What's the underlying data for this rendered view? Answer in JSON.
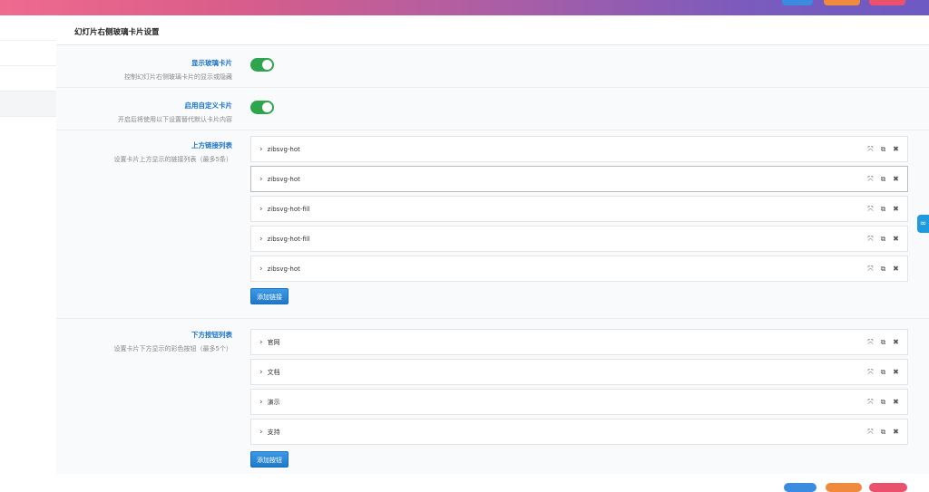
{
  "colors": {
    "accent": "#1a73c8",
    "toggle_on": "#2ea44f",
    "button": "#2587d6"
  },
  "section": {
    "title": "幻灯片右侧玻璃卡片设置"
  },
  "fields": {
    "show_card": {
      "title": "显示玻璃卡片",
      "desc": "控制幻灯片右侧玻璃卡片的显示或隐藏",
      "enabled": true
    },
    "custom_card": {
      "title": "启用自定义卡片",
      "desc": "开启后将使用以下设置替代默认卡片内容",
      "enabled": true
    },
    "link_list": {
      "title": "上方链接列表",
      "desc": "设置卡片上方显示的链接列表（最多5条）",
      "items": [
        {
          "label": "zibsvg-hot"
        },
        {
          "label": "zibsvg-hot"
        },
        {
          "label": "zibsvg-hot-fill"
        },
        {
          "label": "zibsvg-hot-fill"
        },
        {
          "label": "zibsvg-hot"
        }
      ],
      "add_label": "添加链接"
    },
    "button_list": {
      "title": "下方按钮列表",
      "desc": "设置卡片下方显示的彩色按钮（最多5个）",
      "items": [
        {
          "label": "官网"
        },
        {
          "label": "文档"
        },
        {
          "label": "演示"
        },
        {
          "label": "支持"
        }
      ],
      "add_label": "添加按钮"
    }
  },
  "icons": {
    "expand": "expand-icon",
    "copy": "copy-icon",
    "remove": "close-icon",
    "chevron": "chevron-right-icon",
    "float": "link-icon"
  }
}
